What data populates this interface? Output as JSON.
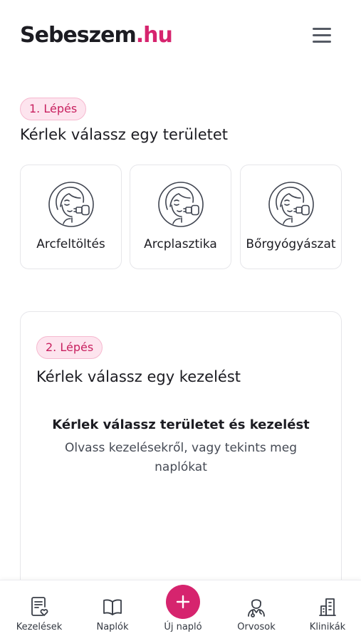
{
  "header": {
    "logo_main": "Sebeszem",
    "logo_dot": ".",
    "logo_tld": "hu",
    "menu_icon": "hamburger-menu-icon"
  },
  "step1": {
    "badge": "1. Lépés",
    "title": "Kérlek válassz egy területet",
    "areas": [
      {
        "label": "Arcfeltöltés",
        "icon": "face-treatment-icon"
      },
      {
        "label": "Arcplasztika",
        "icon": "face-treatment-icon"
      },
      {
        "label": "Bőrgyógyászat",
        "icon": "face-treatment-icon"
      }
    ]
  },
  "step2": {
    "badge": "2. Lépés",
    "title": "Kérlek válassz egy kezelést",
    "empty_title": "Kérlek válassz területet és kezelést",
    "empty_subtitle": "Olvass kezelésekről, vagy tekints meg naplókat"
  },
  "bottom_nav": {
    "items": [
      {
        "label": "Kezelések",
        "icon": "document-heart-icon"
      },
      {
        "label": "Naplók",
        "icon": "book-icon"
      },
      {
        "label": "Új napló",
        "icon": "plus-icon"
      },
      {
        "label": "Orvosok",
        "icon": "doctor-icon"
      },
      {
        "label": "Klinikák",
        "icon": "buildings-icon"
      }
    ]
  },
  "colors": {
    "brand": "#d6246e",
    "badge_bg": "#fde4ee",
    "text": "#1c1c22",
    "border": "#e6e6ea"
  }
}
